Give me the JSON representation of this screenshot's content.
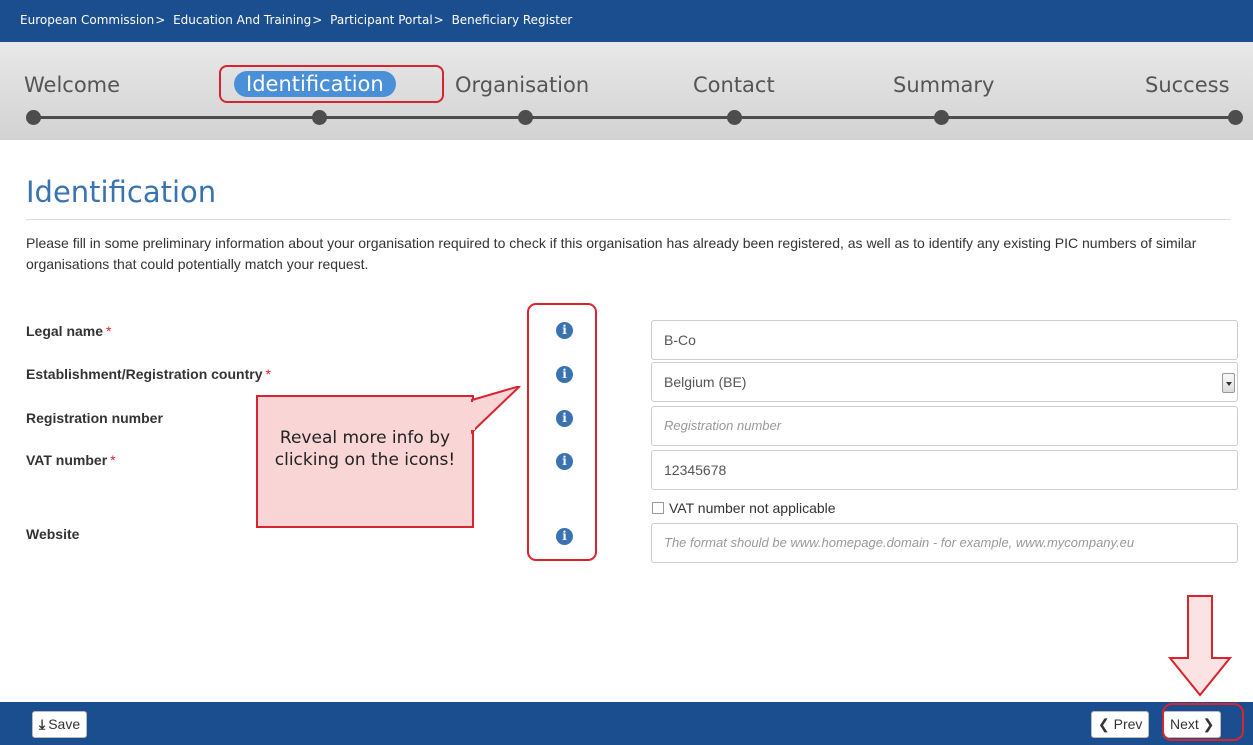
{
  "breadcrumb": {
    "items": [
      "European Commission",
      "Education And Training",
      "Participant Portal",
      "Beneficiary Register"
    ],
    "separator": ">"
  },
  "steps": {
    "labels": [
      "Welcome",
      "Identification",
      "Organisation",
      "Contact",
      "Summary",
      "Success"
    ],
    "active": "Identification"
  },
  "page": {
    "title": "Identification",
    "intro": "Please fill in some preliminary information about your organisation required to check if this organisation has already been registered, as well as to identify any existing PIC numbers of similar organisations that could potentially match your request."
  },
  "form": {
    "legal_name": {
      "label": "Legal name",
      "required_mark": "*",
      "value": "B-Co"
    },
    "country": {
      "label": "Establishment/Registration country",
      "required_mark": "*",
      "value": "Belgium (BE)"
    },
    "registration_number": {
      "label": "Registration number",
      "placeholder": "Registration number"
    },
    "vat_number": {
      "label": "VAT number",
      "required_mark": "*",
      "value": "12345678",
      "not_applicable_label": "VAT number not applicable"
    },
    "website": {
      "label": "Website",
      "placeholder": "The format should be www.homepage.domain - for example, www.mycompany.eu"
    }
  },
  "info_icon_glyph": "i",
  "callout": {
    "text": "Reveal more info by clicking on the icons!"
  },
  "footer": {
    "save_label": "Save",
    "prev_label": "Prev",
    "next_label": "Next"
  },
  "colors": {
    "brand_blue": "#1a4e8f",
    "heading_blue": "#3a73b0",
    "annotation_red": "#d9232e",
    "callout_fill": "#f9d5d5"
  }
}
